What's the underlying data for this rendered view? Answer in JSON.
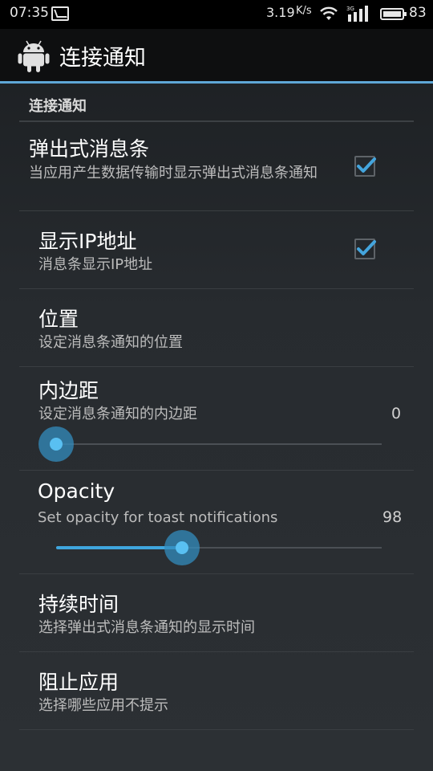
{
  "status_bar": {
    "time": "07:35",
    "network_speed": "3.19",
    "network_speed_unit": "K/s",
    "battery_level": "83",
    "icons": [
      "notification-icon",
      "wifi-icon",
      "signal-icon",
      "battery-icon"
    ]
  },
  "action_bar": {
    "title": "连接通知",
    "app_icon": "android-icon"
  },
  "category": {
    "title": "连接通知"
  },
  "preferences": {
    "popup": {
      "title": "弹出式消息条",
      "summary": "当应用产生数据传输时显示弹出式消息条通知",
      "checked": true
    },
    "show_ip": {
      "title": "显示IP地址",
      "summary": "消息条显示IP地址",
      "checked": true
    },
    "position": {
      "title": "位置",
      "summary": "设定消息条通知的位置"
    },
    "padding": {
      "title": "内边距",
      "summary": "设定消息条通知的内边距",
      "value": "0",
      "slider_fraction": 0.0
    },
    "opacity": {
      "title": "Opacity",
      "summary": "Set opacity for toast notifications",
      "value": "98",
      "slider_fraction": 0.39
    },
    "duration": {
      "title": "持续时间",
      "summary": "选择弹出式消息条通知的显示时间"
    },
    "block_apps": {
      "title": "阻止应用",
      "summary": "选择哪些应用不提示"
    }
  },
  "colors": {
    "accent": "#3fa6de",
    "action_bar_divider": "#5ea7d6"
  }
}
